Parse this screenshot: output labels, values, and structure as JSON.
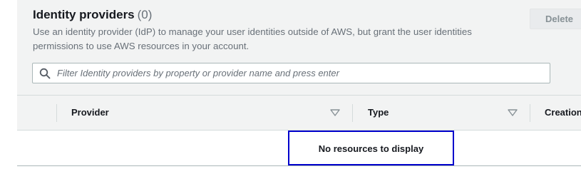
{
  "header": {
    "title": "Identity providers",
    "count": "(0)",
    "description": "Use an identity provider (IdP) to manage your user identities outside of AWS, but grant the user identities permissions to use AWS resources in your account."
  },
  "actions": {
    "delete_label": "Delete"
  },
  "search": {
    "icon": "search-icon",
    "placeholder": "Filter Identity providers by property or provider name and press enter",
    "value": ""
  },
  "table": {
    "columns": [
      {
        "label": "Provider",
        "sort_icon": "sort-down-icon"
      },
      {
        "label": "Type",
        "sort_icon": "sort-down-icon"
      },
      {
        "label": "Creation"
      }
    ],
    "empty_message": "No resources to display"
  },
  "colors": {
    "panel_background": "#f2f3f3",
    "muted_text": "#687078",
    "focus_outline": "#0000cc"
  }
}
